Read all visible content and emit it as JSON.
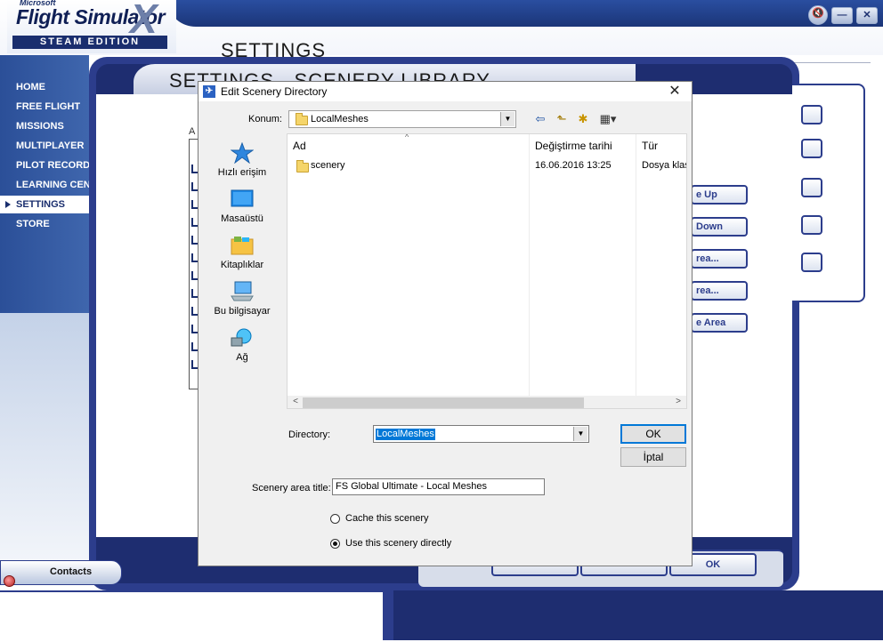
{
  "app": {
    "logo": {
      "ms": "Microsoft",
      "product": "Flight Simulator",
      "x_mark": "X",
      "edition": "STEAM EDITION"
    },
    "page_title": "SETTINGS",
    "panel_title": "SETTINGS - SCENERY LIBRARY",
    "window_controls": [
      "sound-icon",
      "minimize-icon",
      "close-icon"
    ],
    "window_glyphs": {
      "sound": "🔇",
      "minimize": "—",
      "close": "✕"
    },
    "nav": [
      {
        "label": "HOME",
        "active": false
      },
      {
        "label": "FREE FLIGHT",
        "active": false
      },
      {
        "label": "MISSIONS",
        "active": false
      },
      {
        "label": "MULTIPLAYER",
        "active": false
      },
      {
        "label": "PILOT RECORDS",
        "active": false
      },
      {
        "label": "LEARNING CENTER",
        "active": false
      },
      {
        "label": "SETTINGS",
        "active": true
      },
      {
        "label": "STORE",
        "active": false
      }
    ],
    "list_header_fragment": "A",
    "side_buttons": [
      "e Up",
      "Down",
      "rea...",
      "rea...",
      "e Area"
    ],
    "ok_label": "OK",
    "contacts_label": "Contacts",
    "colors": {
      "nav_blue": "#2b4f98",
      "frame_blue": "#2c3d8c",
      "accent": "#0078d7"
    }
  },
  "dialog": {
    "title": "Edit Scenery Directory",
    "close_glyph": "✕",
    "app_icon_glyph": "✈",
    "location_label": "Konum:",
    "location_value": "LocalMeshes",
    "toolbar_glyphs": {
      "back": "⇦",
      "up": "⬑",
      "new_folder": "✱",
      "view": "▦▾"
    },
    "places": [
      {
        "label": "Hızlı erişim",
        "icon": "star-icon"
      },
      {
        "label": "Masaüstü",
        "icon": "desktop-icon"
      },
      {
        "label": "Kitaplıklar",
        "icon": "libraries-icon"
      },
      {
        "label": "Bu bilgisayar",
        "icon": "computer-icon"
      },
      {
        "label": "Ağ",
        "icon": "network-icon"
      }
    ],
    "columns": [
      "Ad",
      "Değiştirme tarihi",
      "Tür"
    ],
    "files": [
      {
        "name": "scenery",
        "modified": "16.06.2016 13:25",
        "type": "Dosya klasörü"
      }
    ],
    "directory_label": "Directory:",
    "directory_value": "LocalMeshes",
    "ok_label": "OK",
    "cancel_label": "İptal",
    "scenery_title_label": "Scenery area title:",
    "scenery_title_value": "FS Global Ultimate - Local Meshes",
    "options": [
      {
        "label": "Cache this scenery",
        "selected": false
      },
      {
        "label": "Use this scenery directly",
        "selected": true
      }
    ]
  }
}
